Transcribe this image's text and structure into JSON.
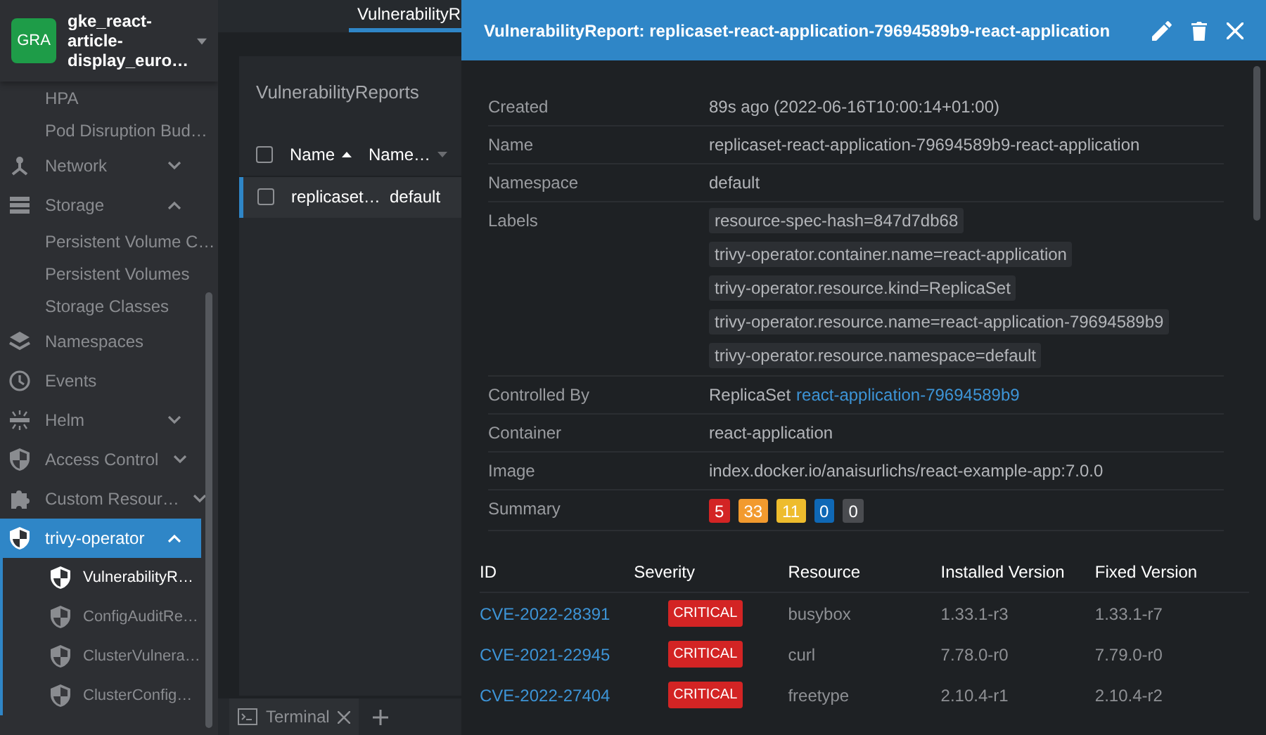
{
  "cluster": {
    "badge": "GRA",
    "name": "gke_react-article-display_euro…"
  },
  "sidebar": {
    "items": [
      {
        "kind": "subitem",
        "label": "HPA",
        "selected": false
      },
      {
        "kind": "subitem",
        "label": "Pod Disruption Bud…",
        "selected": false
      },
      {
        "kind": "group",
        "label": "Network",
        "selected": false,
        "expanded": false
      },
      {
        "kind": "group",
        "label": "Storage",
        "selected": false,
        "expanded": true,
        "children": [
          {
            "label": "Persistent Volume C…",
            "selected": false
          },
          {
            "label": "Persistent Volumes",
            "selected": false
          },
          {
            "label": "Storage Classes",
            "selected": false
          }
        ]
      },
      {
        "kind": "link",
        "label": "Namespaces",
        "selected": false
      },
      {
        "kind": "link",
        "label": "Events",
        "selected": false
      },
      {
        "kind": "group",
        "label": "Helm",
        "selected": false,
        "expanded": false
      },
      {
        "kind": "group",
        "label": "Access Control",
        "selected": false,
        "expanded": false
      },
      {
        "kind": "group",
        "label": "Custom Resour…",
        "selected": false,
        "expanded": false
      },
      {
        "kind": "group",
        "label": "trivy-operator",
        "selected": true,
        "expanded": true,
        "children": [
          {
            "label": "VulnerabilityR…",
            "selected": true
          },
          {
            "label": "ConfigAuditRe…",
            "selected": false
          },
          {
            "label": "ClusterVulnera…",
            "selected": false
          },
          {
            "label": "ClusterConfig…",
            "selected": false
          }
        ]
      }
    ]
  },
  "main_tab": {
    "label": "VulnerabilityR",
    "selected": true
  },
  "list": {
    "title": "VulnerabilityReports",
    "select_all": {
      "checked": false
    },
    "columns": [
      "Name",
      "Name…"
    ],
    "rows": [
      {
        "cells": [
          "replicaset…",
          "default"
        ],
        "selected": true,
        "checked": false
      }
    ]
  },
  "dock": {
    "tab": "Terminal"
  },
  "drawer": {
    "title": "VulnerabilityReport: replicaset-react-application-79694589b9-react-application",
    "details": [
      {
        "kind": "text",
        "label": "Created",
        "value": "89s ago (2022-06-16T10:00:14+01:00)"
      },
      {
        "kind": "text",
        "label": "Name",
        "value": "replicaset-react-application-79694589b9-react-application"
      },
      {
        "kind": "text",
        "label": "Namespace",
        "value": "default"
      },
      {
        "kind": "labels",
        "label": "Labels",
        "values": [
          "resource-spec-hash=847d7db68",
          "trivy-operator.container.name=react-application",
          "trivy-operator.resource.kind=ReplicaSet",
          "trivy-operator.resource.name=react-application-79694589b9",
          "trivy-operator.resource.namespace=default"
        ]
      },
      {
        "kind": "link",
        "label": "Controlled By",
        "prefix": "ReplicaSet",
        "link": "react-application-79694589b9"
      },
      {
        "kind": "text",
        "label": "Container",
        "value": "react-application"
      },
      {
        "kind": "text",
        "label": "Image",
        "value": "index.docker.io/anaisurlichs/react-example-app:7.0.0"
      },
      {
        "kind": "summary",
        "label": "Summary",
        "counts": [
          {
            "value": "5",
            "color": "#d32424"
          },
          {
            "value": "33",
            "color": "#f29a2e"
          },
          {
            "value": "11",
            "color": "#eebc2d"
          },
          {
            "value": "0",
            "color": "#0f68b5"
          },
          {
            "value": "0",
            "color": "#4a4c50"
          }
        ]
      }
    ],
    "vulnerabilities": {
      "columns": [
        "ID",
        "Severity",
        "Resource",
        "Installed Version",
        "Fixed Version"
      ],
      "rows": [
        {
          "id": "CVE-2022-28391",
          "severity": "CRITICAL",
          "color": "#d32424",
          "resource": "busybox",
          "installed": "1.33.1-r3",
          "fixed": "1.33.1-r7"
        },
        {
          "id": "CVE-2021-22945",
          "severity": "CRITICAL",
          "color": "#d32424",
          "resource": "curl",
          "installed": "7.78.0-r0",
          "fixed": "7.79.0-r0"
        },
        {
          "id": "CVE-2022-27404",
          "severity": "CRITICAL",
          "color": "#d32424",
          "resource": "freetype",
          "installed": "2.10.4-r1",
          "fixed": "2.10.4-r2"
        }
      ]
    }
  }
}
